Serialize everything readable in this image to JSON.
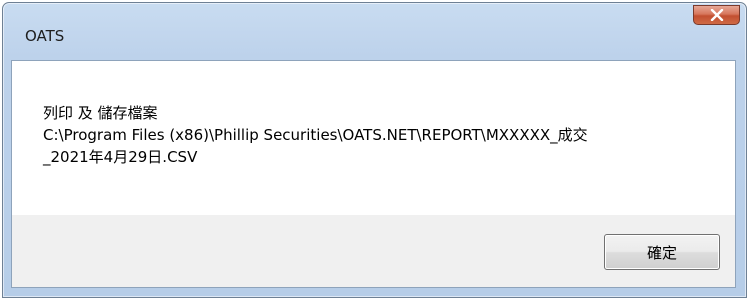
{
  "window": {
    "title": "OATS"
  },
  "close_button": {
    "icon": "close-icon",
    "color": "#c24f31"
  },
  "message": {
    "line1": "列印 及 儲存檔案",
    "line2": "C:\\Program Files (x86)\\Phillip Securities\\OATS.NET\\REPORT\\MXXXXX_成交",
    "line3": "_2021年4月29日.CSV"
  },
  "buttons": {
    "ok_label": "確定"
  }
}
